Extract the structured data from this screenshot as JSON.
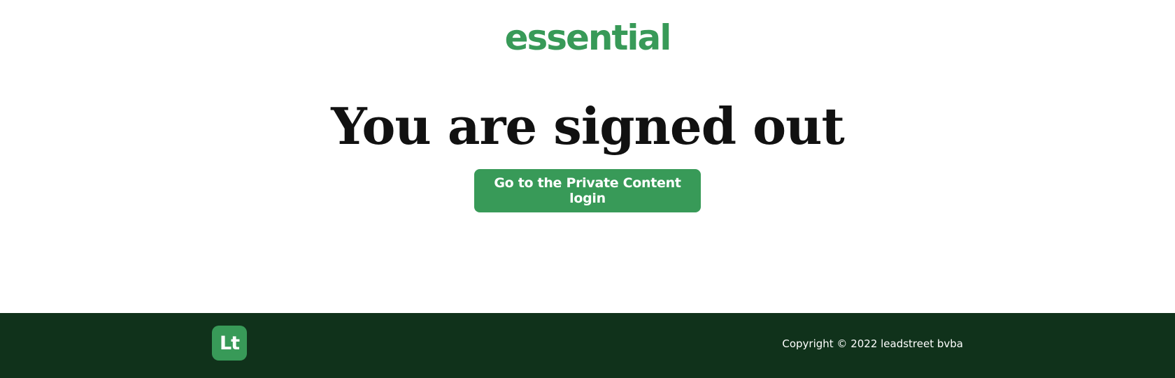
{
  "header": {
    "logo_text": "essential"
  },
  "main": {
    "title": "You are signed out",
    "cta_label": "Go to the Private Content login"
  },
  "footer": {
    "badge_text": "Lt",
    "copyright": "Copyright © 2022 leadstreet bvba"
  },
  "colors": {
    "brand_green": "#389a58",
    "footer_bg": "#10321b",
    "title_text": "#111111"
  }
}
